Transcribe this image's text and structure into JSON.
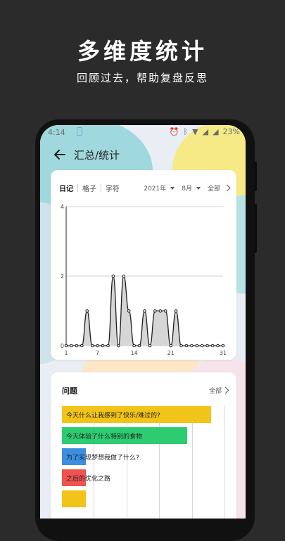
{
  "header": {
    "title": "多维度统计",
    "subtitle": "回顾过去，帮助复盘反思"
  },
  "status_bar": {
    "time": "4:14",
    "battery": "23%"
  },
  "app_bar": {
    "title": "汇总/统计"
  },
  "stats_card": {
    "tabs": [
      {
        "label": "日记",
        "active": true
      },
      {
        "label": "格子",
        "active": false
      },
      {
        "label": "字符",
        "active": false
      }
    ],
    "year": "2021年",
    "month": "8月",
    "all_label": "全部"
  },
  "chart_data": {
    "type": "area",
    "x": [
      1,
      2,
      3,
      4,
      5,
      6,
      7,
      8,
      9,
      10,
      11,
      12,
      13,
      14,
      15,
      16,
      17,
      18,
      19,
      20,
      21,
      22,
      23,
      24,
      25,
      26,
      27,
      28,
      29,
      30,
      31
    ],
    "series": [
      {
        "values": [
          0,
          0,
          0,
          0,
          1,
          0,
          0,
          0,
          0,
          2,
          0,
          2,
          1,
          0,
          0,
          1,
          0,
          1,
          1,
          1,
          0,
          1,
          0,
          0,
          0,
          0,
          0,
          0,
          0,
          0,
          0
        ]
      }
    ],
    "x_ticks": [
      "1",
      "7",
      "14",
      "21",
      "31"
    ],
    "y_ticks": [
      "0",
      "2",
      "4"
    ],
    "ylim": [
      0,
      4
    ],
    "xlim": [
      1,
      31
    ],
    "grid": true
  },
  "question_card": {
    "title": "问题",
    "all_label": "全部",
    "bars": [
      {
        "label": "今天什么让我感到了快乐/难过的?",
        "value": 10,
        "color": "#f2c318"
      },
      {
        "label": "今天体验了什么特别的食物",
        "value": 8.4,
        "color": "#2ecc71"
      },
      {
        "label": "为了实现梦想我做了什么?",
        "value": 1,
        "color": "#3b8fe0"
      },
      {
        "label": "之后的优化之路",
        "value": 1,
        "color": "#ef5350"
      },
      {
        "label": "",
        "value": 1,
        "color": "#f2c318"
      }
    ]
  }
}
